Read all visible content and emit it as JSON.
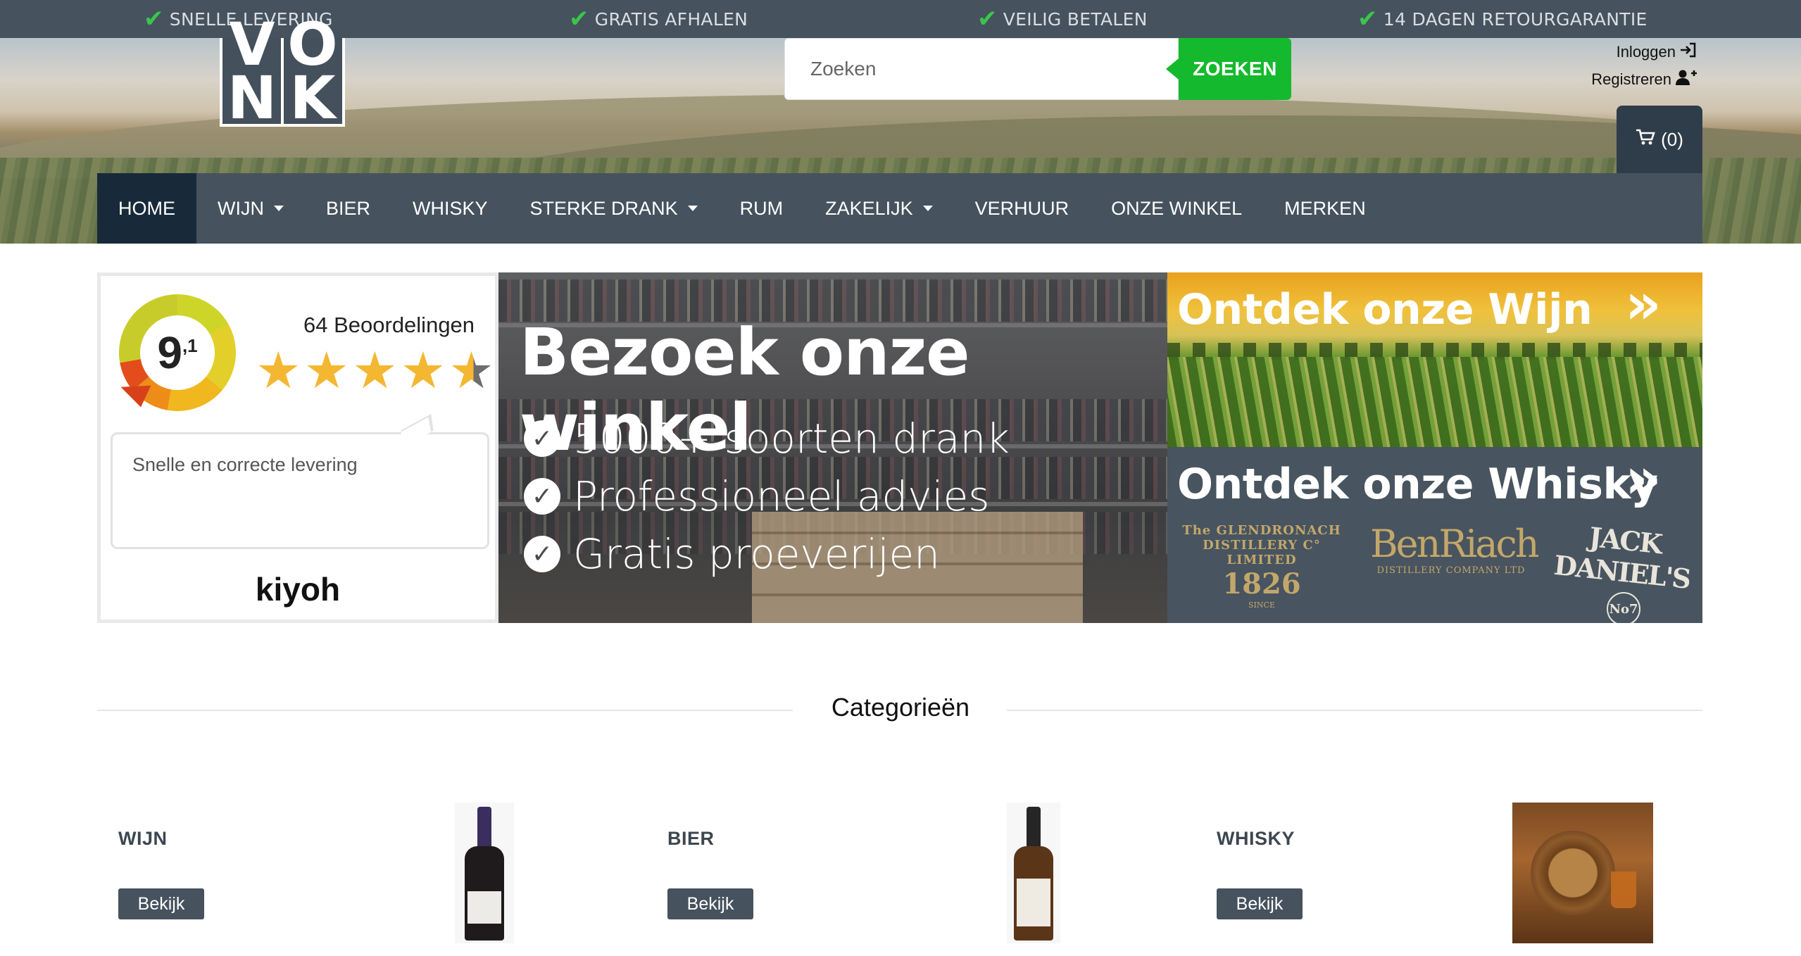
{
  "usps": [
    {
      "label": "SNELLE LEVERING"
    },
    {
      "label": "GRATIS AFHALEN"
    },
    {
      "label": "VEILIG BETALEN"
    },
    {
      "label": "14 DAGEN RETOURGARANTIE"
    }
  ],
  "logo": {
    "letters": [
      "V",
      "O",
      "N",
      "K"
    ]
  },
  "search": {
    "placeholder": "Zoeken",
    "button_label": "ZOEKEN"
  },
  "account": {
    "login_label": "Inloggen",
    "register_label": "Registreren"
  },
  "cart": {
    "label": "(0)"
  },
  "nav": {
    "items": [
      {
        "label": "HOME"
      },
      {
        "label": "WIJN"
      },
      {
        "label": "BIER"
      },
      {
        "label": "WHISKY"
      },
      {
        "label": "STERKE DRANK"
      },
      {
        "label": "RUM"
      },
      {
        "label": "ZAKELIJK"
      },
      {
        "label": "VERHUUR"
      },
      {
        "label": "ONZE WINKEL"
      },
      {
        "label": "MERKEN"
      }
    ]
  },
  "kiyoh": {
    "score_main": "9",
    "score_decimal": ",1",
    "review_count": "64 Beoordelingen",
    "stars": 4.5,
    "review_text": "Snelle en correcte levering",
    "brand": "kiyoh"
  },
  "store_banner": {
    "title": "Bezoek onze winkel",
    "features": [
      "5000+ soorten drank",
      "Professioneel advies",
      "Gratis proeverijen"
    ]
  },
  "wine_banner": {
    "title": "Ontdek onze Wijn",
    "arrows": "»"
  },
  "whisky_banner": {
    "title": "Ontdek onze Whisky",
    "arrows": "»",
    "brands": {
      "glendronach": {
        "name": "The GLENDRONACH DISTILLERY C° LIMITED",
        "year": "1826",
        "since": "SINCE"
      },
      "benriach": {
        "name": "BenRiach",
        "sub": "DISTILLERY COMPANY LTD"
      },
      "jack": {
        "name": "JACK DANIEL'S",
        "badge": "No7"
      }
    }
  },
  "categories": {
    "title": "Categorieën",
    "items": [
      {
        "name": "WIJN",
        "button_label": "Bekijk"
      },
      {
        "name": "BIER",
        "button_label": "Bekijk"
      },
      {
        "name": "WHISKY",
        "button_label": "Bekijk"
      }
    ]
  },
  "colors": {
    "top_bar": "#46525d",
    "nav": "#46525d",
    "nav_active": "#182a39",
    "search_button": "#15b92e",
    "check": "#39c64a",
    "star": "#f4b731"
  }
}
